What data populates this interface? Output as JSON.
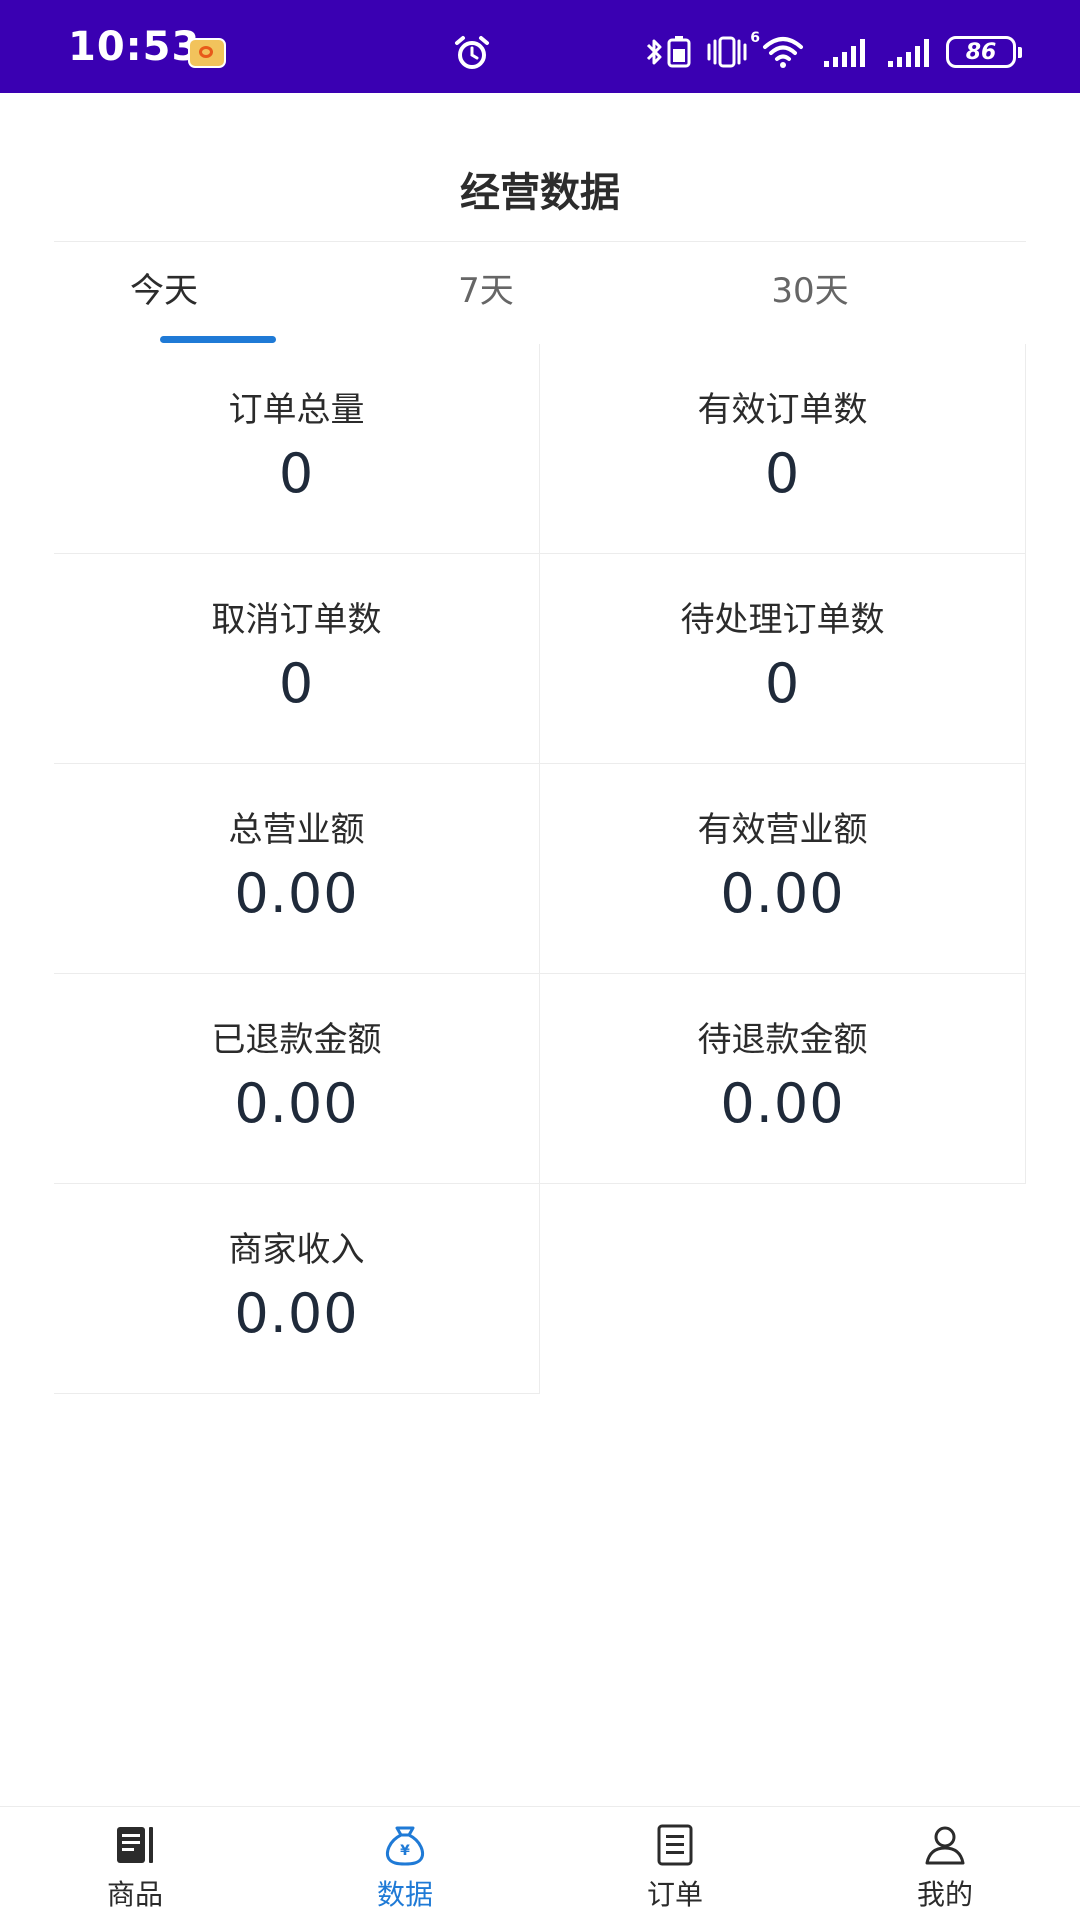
{
  "status_bar": {
    "time": "10:53",
    "network_label": "6",
    "battery": "86"
  },
  "header": {
    "title": "经营数据"
  },
  "tabs": [
    {
      "label": "今天",
      "active": true
    },
    {
      "label": "7天",
      "active": false
    },
    {
      "label": "30天",
      "active": false
    }
  ],
  "stats": [
    {
      "label": "订单总量",
      "value": "0"
    },
    {
      "label": "有效订单数",
      "value": "0"
    },
    {
      "label": "取消订单数",
      "value": "0"
    },
    {
      "label": "待处理订单数",
      "value": "0"
    },
    {
      "label": "总营业额",
      "value": "0.00"
    },
    {
      "label": "有效营业额",
      "value": "0.00"
    },
    {
      "label": "已退款金额",
      "value": "0.00"
    },
    {
      "label": "待退款金额",
      "value": "0.00"
    },
    {
      "label": "商家收入",
      "value": "0.00"
    }
  ],
  "bottom_nav": [
    {
      "label": "商品",
      "icon": "book-icon",
      "active": false
    },
    {
      "label": "数据",
      "icon": "money-bag-icon",
      "active": true
    },
    {
      "label": "订单",
      "icon": "document-icon",
      "active": false
    },
    {
      "label": "我的",
      "icon": "person-icon",
      "active": false
    }
  ],
  "colors": {
    "status_bar": "#3a00b2",
    "accent": "#1f7ad6",
    "value_text": "#1f2a3a",
    "divider": "#ececec"
  }
}
